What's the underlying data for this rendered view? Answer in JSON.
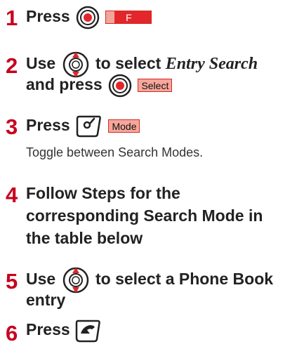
{
  "steps": [
    {
      "number": "1",
      "text_a": "Press",
      "softkey": "F"
    },
    {
      "number": "2",
      "text_a": "Use",
      "text_b": "to select",
      "italic": "Entry Search",
      "text_c": "and press",
      "softkey": "Select"
    },
    {
      "number": "3",
      "text_a": "Press",
      "softkey": "Mode",
      "note": "Toggle between Search Modes."
    },
    {
      "number": "4",
      "line1": "Follow Steps for the",
      "line2": "corresponding Search Mode in",
      "line3": "the table below"
    },
    {
      "number": "5",
      "text_a": "Use",
      "text_b": "to select a Phone Book",
      "line2": "entry"
    },
    {
      "number": "6",
      "text_a": "Press"
    }
  ],
  "icons": {
    "center_key": "center-key-icon",
    "nav_key": "navigation-key-icon",
    "mode_key": "mode-key-icon",
    "send_key": "send-key-icon"
  },
  "colors": {
    "step_number": "#c8001e",
    "softkey_fill": "#f6a79b",
    "softkey_border": "#d32a22",
    "key_red": "#e3262b"
  }
}
